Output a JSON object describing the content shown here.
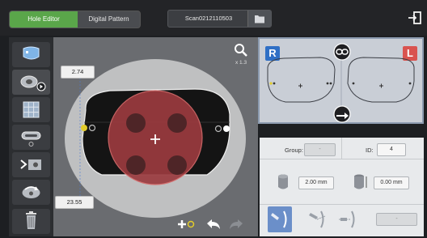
{
  "topbar": {
    "tabs": [
      {
        "label": "Hole Editor",
        "active": true
      },
      {
        "label": "Digital Pattern",
        "active": false
      }
    ],
    "filename": "Scan0212110503",
    "folder_icon": "folder-icon",
    "exit_icon": "exit-icon"
  },
  "tools": [
    {
      "name": "lens-shape-icon",
      "active": false
    },
    {
      "name": "hole-play-icon",
      "active": true
    },
    {
      "name": "grid-select-icon",
      "active": false
    },
    {
      "name": "slot-icon",
      "active": false
    },
    {
      "name": "notch-icon",
      "active": false
    },
    {
      "name": "rotate-icon",
      "active": false
    },
    {
      "name": "trash-icon",
      "active": false
    }
  ],
  "canvas": {
    "zoom_label": "x 1.3",
    "top_value": "2.74",
    "bottom_value": "23.55"
  },
  "preview": {
    "right_label": "R",
    "left_label": "L",
    "right_color": "#2f6fc5",
    "left_color": "#d9534f"
  },
  "properties": {
    "group_label": "Group:",
    "group_value": "-",
    "id_label": "ID:",
    "id_value": "4",
    "diameter_value": "2.00 mm",
    "depth_value": "0.00 mm",
    "angle_value": "-"
  },
  "colors": {
    "accent": "#5aa64a",
    "hole_fill": "#9b3b3f"
  }
}
